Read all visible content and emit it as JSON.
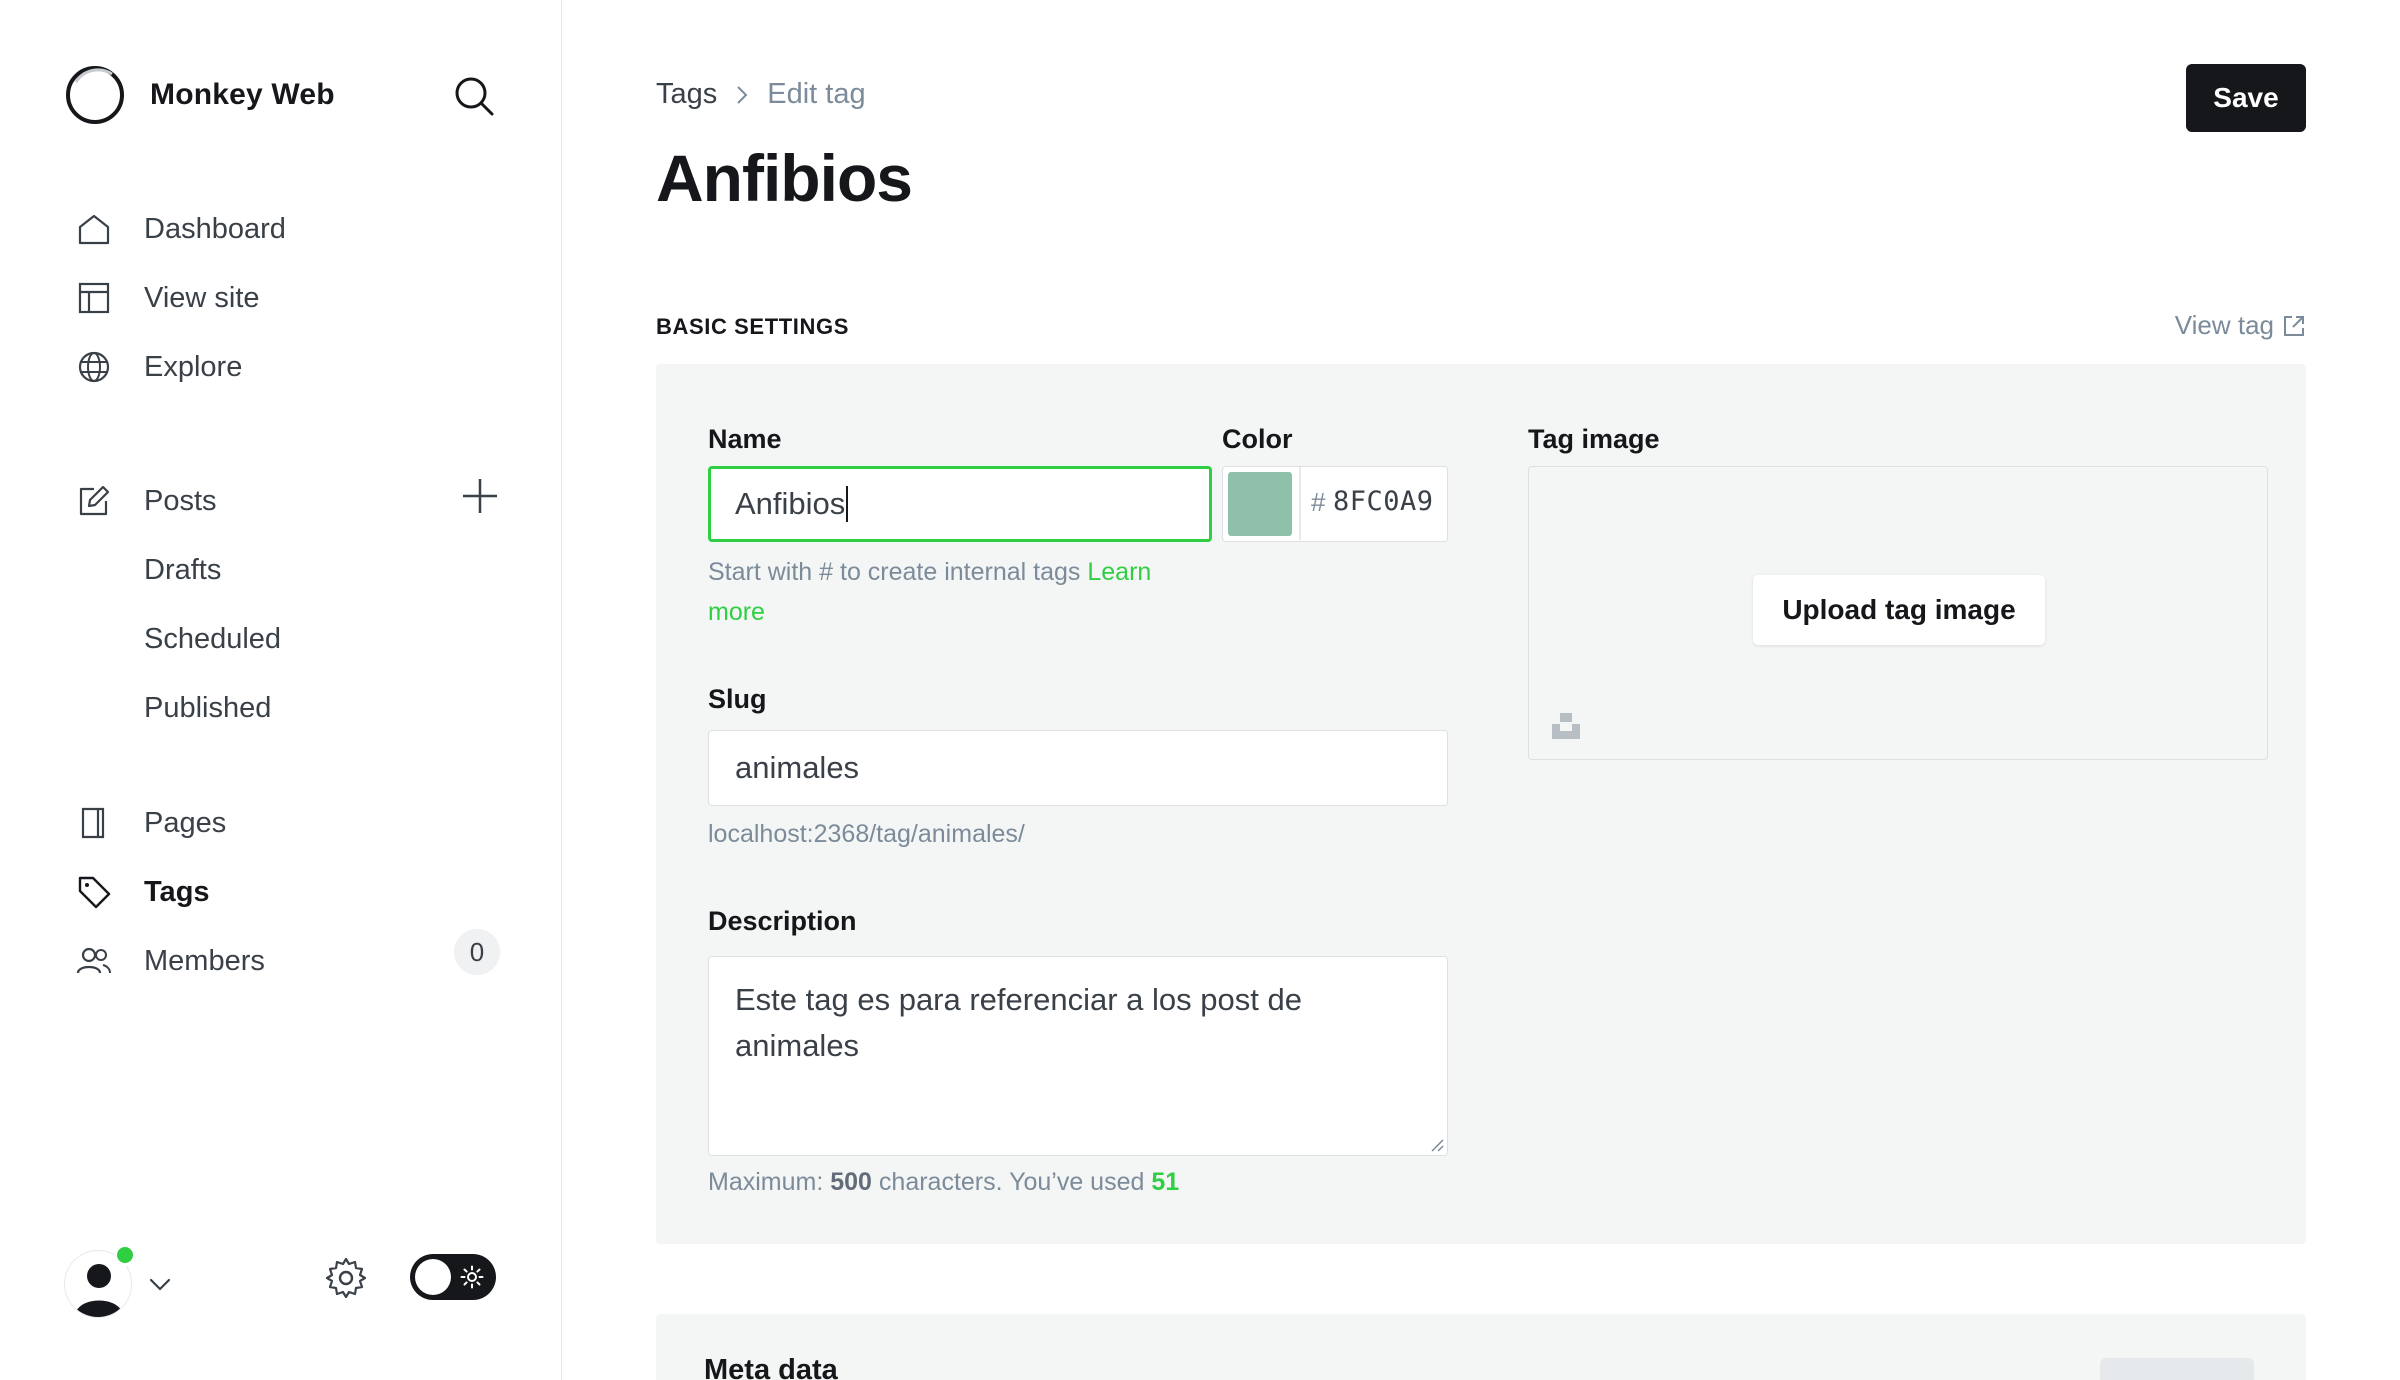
{
  "app": {
    "name": "Monkey Web"
  },
  "sidebar": {
    "items": [
      {
        "label": "Dashboard",
        "icon": "home-icon"
      },
      {
        "label": "View site",
        "icon": "layout-icon"
      },
      {
        "label": "Explore",
        "icon": "globe-icon"
      },
      {
        "label": "Posts",
        "icon": "edit-icon"
      },
      {
        "label": "Pages",
        "icon": "page-icon"
      },
      {
        "label": "Tags",
        "icon": "tag-icon",
        "active": true
      },
      {
        "label": "Members",
        "icon": "members-icon",
        "count": "0"
      }
    ],
    "post_subitems": [
      "Drafts",
      "Scheduled",
      "Published"
    ]
  },
  "header": {
    "breadcrumb_parent": "Tags",
    "breadcrumb_current": "Edit tag",
    "title": "Anfibios",
    "save_label": "Save"
  },
  "basic_settings": {
    "section_label": "BASIC SETTINGS",
    "view_tag_label": "View tag",
    "name_label": "Name",
    "name_value": "Anfibios",
    "name_hint_prefix": "Start with # to create internal tags",
    "name_hint_link_1": "Learn",
    "name_hint_link_2": "more",
    "color_label": "Color",
    "color_hash": "#",
    "color_value": "8FC0A9",
    "color_swatch": "#8fc0a9",
    "slug_label": "Slug",
    "slug_value": "animales",
    "slug_url": "localhost:2368/tag/animales/",
    "description_label": "Description",
    "description_value": "Este tag es para referenciar a los post de animales",
    "desc_hint_prefix": "Maximum:",
    "desc_hint_max": "500",
    "desc_hint_middle": "characters. You’ve used",
    "desc_hint_used": "51",
    "tag_image_label": "Tag image",
    "upload_label": "Upload tag image"
  },
  "meta_data": {
    "title": "Meta data"
  },
  "colors": {
    "accent_green": "#30cf43",
    "dark": "#15171a",
    "panel_bg": "#f4f5f5"
  }
}
